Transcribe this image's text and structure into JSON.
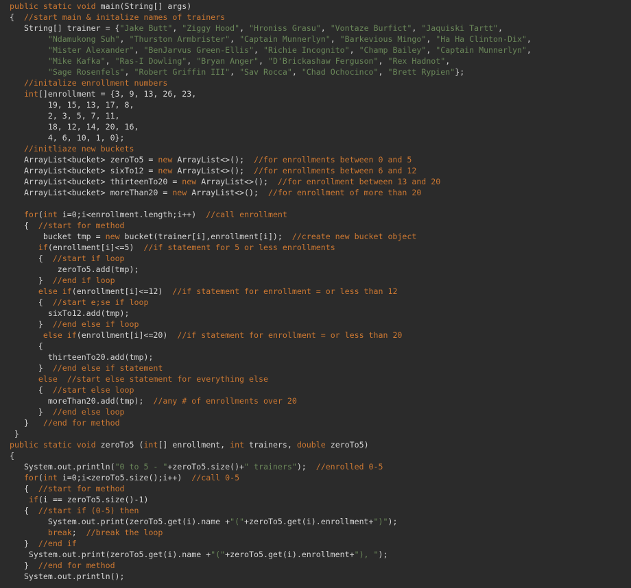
{
  "editor": {
    "language": "java",
    "colors": {
      "background": "#2b2b2b",
      "keyword": "#cc7832",
      "string": "#6a8759",
      "comment": "#cc7832",
      "plain": "#d4d4d4"
    },
    "lines": [
      [
        [
          "kw",
          "public static void "
        ],
        [
          "plain",
          "main(String[] args)"
        ]
      ],
      [
        [
          "plain",
          "{  "
        ],
        [
          "cmt",
          "//start main & initalize names of trainers"
        ]
      ],
      [
        [
          "plain",
          "   String[] trainer = {"
        ],
        [
          "str",
          "\"Jake Butt\""
        ],
        [
          "plain",
          ", "
        ],
        [
          "str",
          "\"Ziggy Hood\""
        ],
        [
          "plain",
          ", "
        ],
        [
          "str",
          "\"Hroniss Grasu\""
        ],
        [
          "plain",
          ", "
        ],
        [
          "str",
          "\"Vontaze Burfict\""
        ],
        [
          "plain",
          ", "
        ],
        [
          "str",
          "\"Jaquiski Tartt\""
        ],
        [
          "plain",
          ","
        ]
      ],
      [
        [
          "plain",
          "        "
        ],
        [
          "str",
          "\"Ndamukong Suh\""
        ],
        [
          "plain",
          ", "
        ],
        [
          "str",
          "\"Thurston Armbrister\""
        ],
        [
          "plain",
          ", "
        ],
        [
          "str",
          "\"Captain Munnerlyn\""
        ],
        [
          "plain",
          ", "
        ],
        [
          "str",
          "\"Barkevious Mingo\""
        ],
        [
          "plain",
          ", "
        ],
        [
          "str",
          "\"Ha Ha Clinton-Dix\""
        ],
        [
          "plain",
          ","
        ]
      ],
      [
        [
          "plain",
          "        "
        ],
        [
          "str",
          "\"Mister Alexander\""
        ],
        [
          "plain",
          ", "
        ],
        [
          "str",
          "\"BenJarvus Green-Ellis\""
        ],
        [
          "plain",
          ", "
        ],
        [
          "str",
          "\"Richie Incognito\""
        ],
        [
          "plain",
          ", "
        ],
        [
          "str",
          "\"Champ Bailey\""
        ],
        [
          "plain",
          ", "
        ],
        [
          "str",
          "\"Captain Munnerlyn\""
        ],
        [
          "plain",
          ","
        ]
      ],
      [
        [
          "plain",
          "        "
        ],
        [
          "str",
          "\"Mike Kafka\""
        ],
        [
          "plain",
          ", "
        ],
        [
          "str",
          "\"Ras-I Dowling\""
        ],
        [
          "plain",
          ", "
        ],
        [
          "str",
          "\"Bryan Anger\""
        ],
        [
          "plain",
          ", "
        ],
        [
          "str",
          "\"D'Brickashaw Ferguson\""
        ],
        [
          "plain",
          ", "
        ],
        [
          "str",
          "\"Rex Hadnot\""
        ],
        [
          "plain",
          ","
        ]
      ],
      [
        [
          "plain",
          "        "
        ],
        [
          "str",
          "\"Sage Rosenfels\""
        ],
        [
          "plain",
          ", "
        ],
        [
          "str",
          "\"Robert Griffin III\""
        ],
        [
          "plain",
          ", "
        ],
        [
          "str",
          "\"Sav Rocca\""
        ],
        [
          "plain",
          ", "
        ],
        [
          "str",
          "\"Chad Ochocinco\""
        ],
        [
          "plain",
          ", "
        ],
        [
          "str",
          "\"Brett Rypien\""
        ],
        [
          "plain",
          "};"
        ]
      ],
      [
        [
          "plain",
          "   "
        ],
        [
          "cmt",
          "//initalize enrollment numbers"
        ]
      ],
      [
        [
          "plain",
          "   "
        ],
        [
          "kw",
          "int"
        ],
        [
          "plain",
          "[]enrollment = {3, 9, 13, 26, 23,"
        ]
      ],
      [
        [
          "plain",
          "        19, 15, 13, 17, 8,"
        ]
      ],
      [
        [
          "plain",
          "        2, 3, 5, 7, 11,"
        ]
      ],
      [
        [
          "plain",
          "        18, 12, 14, 20, 16,"
        ]
      ],
      [
        [
          "plain",
          "        4, 6, 10, 1, 0};"
        ]
      ],
      [
        [
          "plain",
          "   "
        ],
        [
          "cmt",
          "//initliaze new buckets"
        ]
      ],
      [
        [
          "plain",
          "   ArrayList<bucket> zeroTo5 = "
        ],
        [
          "kw",
          "new"
        ],
        [
          "plain",
          " ArrayList<>();  "
        ],
        [
          "cmt",
          "//for enrollments between 0 and 5"
        ]
      ],
      [
        [
          "plain",
          "   ArrayList<bucket> sixTo12 = "
        ],
        [
          "kw",
          "new"
        ],
        [
          "plain",
          " ArrayList<>();  "
        ],
        [
          "cmt",
          "//for enrollments between 6 and 12"
        ]
      ],
      [
        [
          "plain",
          "   ArrayList<bucket> thirteenTo20 = "
        ],
        [
          "kw",
          "new"
        ],
        [
          "plain",
          " ArrayList<>();  "
        ],
        [
          "cmt",
          "//for enrollment between 13 and 20"
        ]
      ],
      [
        [
          "plain",
          "   ArrayList<bucket> moreThan20 = "
        ],
        [
          "kw",
          "new"
        ],
        [
          "plain",
          " ArrayList<>();  "
        ],
        [
          "cmt",
          "//for enrollment of more than 20"
        ]
      ],
      [],
      [
        [
          "plain",
          "   "
        ],
        [
          "kw",
          "for"
        ],
        [
          "plain",
          "("
        ],
        [
          "kw",
          "int"
        ],
        [
          "plain",
          " i=0;i<enrollment.length;i++)  "
        ],
        [
          "cmt",
          "//call enrollment"
        ]
      ],
      [
        [
          "plain",
          "   {  "
        ],
        [
          "cmt",
          "//start for method"
        ]
      ],
      [
        [
          "plain",
          "       bucket tmp = "
        ],
        [
          "kw",
          "new"
        ],
        [
          "plain",
          " bucket(trainer[i],enrollment[i]);  "
        ],
        [
          "cmt",
          "//create new bucket object"
        ]
      ],
      [
        [
          "plain",
          "      "
        ],
        [
          "kw",
          "if"
        ],
        [
          "plain",
          "(enrollment[i]<=5)  "
        ],
        [
          "cmt",
          "//if statement for 5 or less enrollments"
        ]
      ],
      [
        [
          "plain",
          "      {  "
        ],
        [
          "cmt",
          "//start if loop"
        ]
      ],
      [
        [
          "plain",
          "          zeroTo5.add(tmp);"
        ]
      ],
      [
        [
          "plain",
          "      }  "
        ],
        [
          "cmt",
          "//end if loop"
        ]
      ],
      [
        [
          "plain",
          "      "
        ],
        [
          "kw",
          "else if"
        ],
        [
          "plain",
          "(enrollment[i]<=12)  "
        ],
        [
          "cmt",
          "//if statement for enrollment = or less than 12"
        ]
      ],
      [
        [
          "plain",
          "      {  "
        ],
        [
          "cmt",
          "//start e;se if loop"
        ]
      ],
      [
        [
          "plain",
          "        sixTo12.add(tmp);"
        ]
      ],
      [
        [
          "plain",
          "      }  "
        ],
        [
          "cmt",
          "//end else if loop"
        ]
      ],
      [
        [
          "plain",
          "       "
        ],
        [
          "kw",
          "else if"
        ],
        [
          "plain",
          "(enrollment[i]<=20)  "
        ],
        [
          "cmt",
          "//if statement for enrollment = or less than 20"
        ]
      ],
      [
        [
          "plain",
          "      {"
        ]
      ],
      [
        [
          "plain",
          "        thirteenTo20.add(tmp);"
        ]
      ],
      [
        [
          "plain",
          "      }  "
        ],
        [
          "cmt",
          "//end else if statement"
        ]
      ],
      [
        [
          "plain",
          "      "
        ],
        [
          "kw",
          "else"
        ],
        [
          "plain",
          "  "
        ],
        [
          "cmt",
          "//start else statement for everything else"
        ]
      ],
      [
        [
          "plain",
          "      {  "
        ],
        [
          "cmt",
          "//start else loop"
        ]
      ],
      [
        [
          "plain",
          "        moreThan20.add(tmp);  "
        ],
        [
          "cmt",
          "//any # of enrollments over 20"
        ]
      ],
      [
        [
          "plain",
          "      }  "
        ],
        [
          "cmt",
          "//end else loop"
        ]
      ],
      [
        [
          "plain",
          "   }   "
        ],
        [
          "cmt",
          "//end for method"
        ]
      ],
      [
        [
          "plain",
          " }"
        ]
      ],
      [
        [
          "kw",
          "public static void "
        ],
        [
          "plain",
          "zeroTo5 ("
        ],
        [
          "kw",
          "int"
        ],
        [
          "plain",
          "[] enrollment, "
        ],
        [
          "kw",
          "int"
        ],
        [
          "plain",
          " trainers, "
        ],
        [
          "kw",
          "double"
        ],
        [
          "plain",
          " zeroTo5)"
        ]
      ],
      [
        [
          "plain",
          "{"
        ]
      ],
      [
        [
          "plain",
          "   System.out.println("
        ],
        [
          "str",
          "\"0 to 5 - \""
        ],
        [
          "plain",
          "+zeroTo5.size()+"
        ],
        [
          "str",
          "\" trainers\""
        ],
        [
          "plain",
          ");  "
        ],
        [
          "cmt",
          "//enrolled 0-5"
        ]
      ],
      [
        [
          "plain",
          "   "
        ],
        [
          "kw",
          "for"
        ],
        [
          "plain",
          "("
        ],
        [
          "kw",
          "int"
        ],
        [
          "plain",
          " i=0;i<zeroTo5.size();i++)  "
        ],
        [
          "cmt",
          "//call 0-5"
        ]
      ],
      [
        [
          "plain",
          "   {  "
        ],
        [
          "cmt",
          "//start for method"
        ]
      ],
      [
        [
          "plain",
          "    "
        ],
        [
          "kw",
          "if"
        ],
        [
          "plain",
          "(i == zeroTo5.size()-1)"
        ]
      ],
      [
        [
          "plain",
          "   {  "
        ],
        [
          "cmt",
          "//start if (0-5) then"
        ]
      ],
      [
        [
          "plain",
          "        System.out.print(zeroTo5.get(i).name +"
        ],
        [
          "str",
          "\"(\""
        ],
        [
          "plain",
          "+zeroTo5.get(i).enrollment+"
        ],
        [
          "str",
          "\")\""
        ],
        [
          "plain",
          ");"
        ]
      ],
      [
        [
          "plain",
          "        "
        ],
        [
          "kw",
          "break"
        ],
        [
          "plain",
          ";  "
        ],
        [
          "cmt",
          "//break the loop"
        ]
      ],
      [
        [
          "plain",
          "   }  "
        ],
        [
          "cmt",
          "//end if"
        ]
      ],
      [
        [
          "plain",
          "    System.out.print(zeroTo5.get(i).name +"
        ],
        [
          "str",
          "\"(\""
        ],
        [
          "plain",
          "+zeroTo5.get(i).enrollment+"
        ],
        [
          "str",
          "\"), \""
        ],
        [
          "plain",
          ");"
        ]
      ],
      [
        [
          "plain",
          "   }  "
        ],
        [
          "cmt",
          "//end for method"
        ]
      ],
      [
        [
          "plain",
          "   System.out.println();"
        ]
      ]
    ]
  }
}
